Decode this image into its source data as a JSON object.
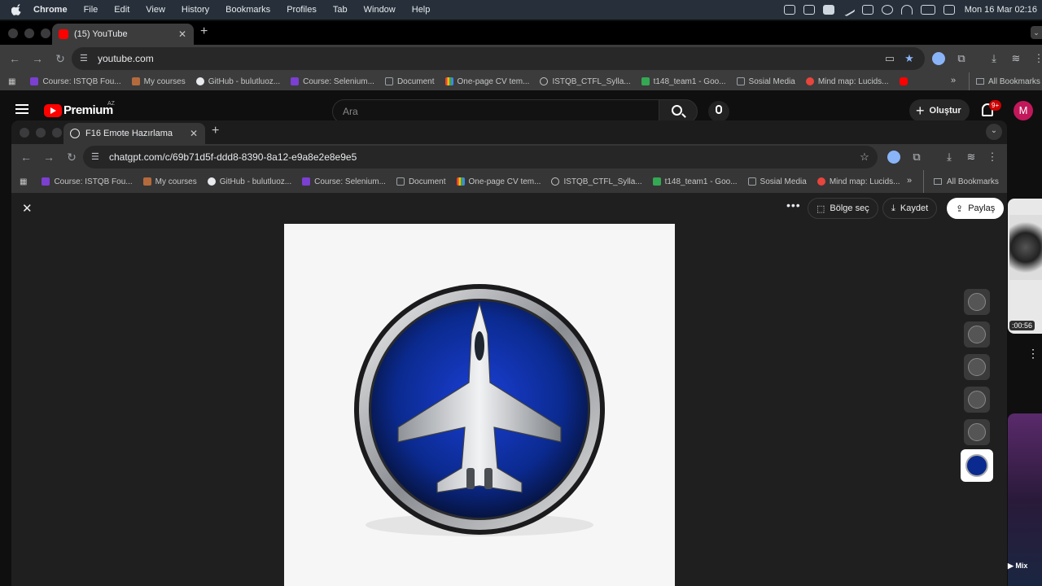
{
  "menubar": {
    "app": "Chrome",
    "items": [
      "File",
      "Edit",
      "View",
      "History",
      "Bookmarks",
      "Profiles",
      "Tab",
      "Window",
      "Help"
    ],
    "clock": "Mon 16 Mar  02:16"
  },
  "outer_browser": {
    "tab_title": "(15) YouTube",
    "url": "youtube.com",
    "bookmarks": [
      "Course: ISTQB Fou...",
      "My courses",
      "GitHub - bulutluoz...",
      "Course: Selenium...",
      "Document",
      "One-page CV tem...",
      "ISTQB_CTFL_Sylla...",
      "t148_team1 - Goo...",
      "Sosial Media",
      "Mind map: Lucids..."
    ],
    "all_bookmarks": "All Bookmarks"
  },
  "youtube": {
    "logo_text": "Premium",
    "region": "AZ",
    "search_placeholder": "Ara",
    "create_label": "Oluştur",
    "notif_count": "9+",
    "avatar_letter": "M",
    "video_duration": ":00:56",
    "mix_label": "Mix"
  },
  "inner_browser": {
    "tab_title": "F16 Emote Hazırlama",
    "url": "chatgpt.com/c/69b71d5f-ddd8-8390-8a12-e9a8e2e8e9e5",
    "bookmarks": [
      "Course: ISTQB Fou...",
      "My courses",
      "GitHub - bulutluoz...",
      "Course: Selenium...",
      "Document",
      "One-page CV tem...",
      "ISTQB_CTFL_Sylla...",
      "t148_team1 - Goo...",
      "Sosial Media",
      "Mind map: Lucids..."
    ],
    "all_bookmarks": "All Bookmarks"
  },
  "viewer": {
    "select_region": "Bölge seç",
    "save": "Kaydet",
    "share": "Paylaş"
  },
  "colors": {
    "yt_red": "#ff0000",
    "badge_blue": "#0b2a8f",
    "avatar": "#c2185b"
  }
}
